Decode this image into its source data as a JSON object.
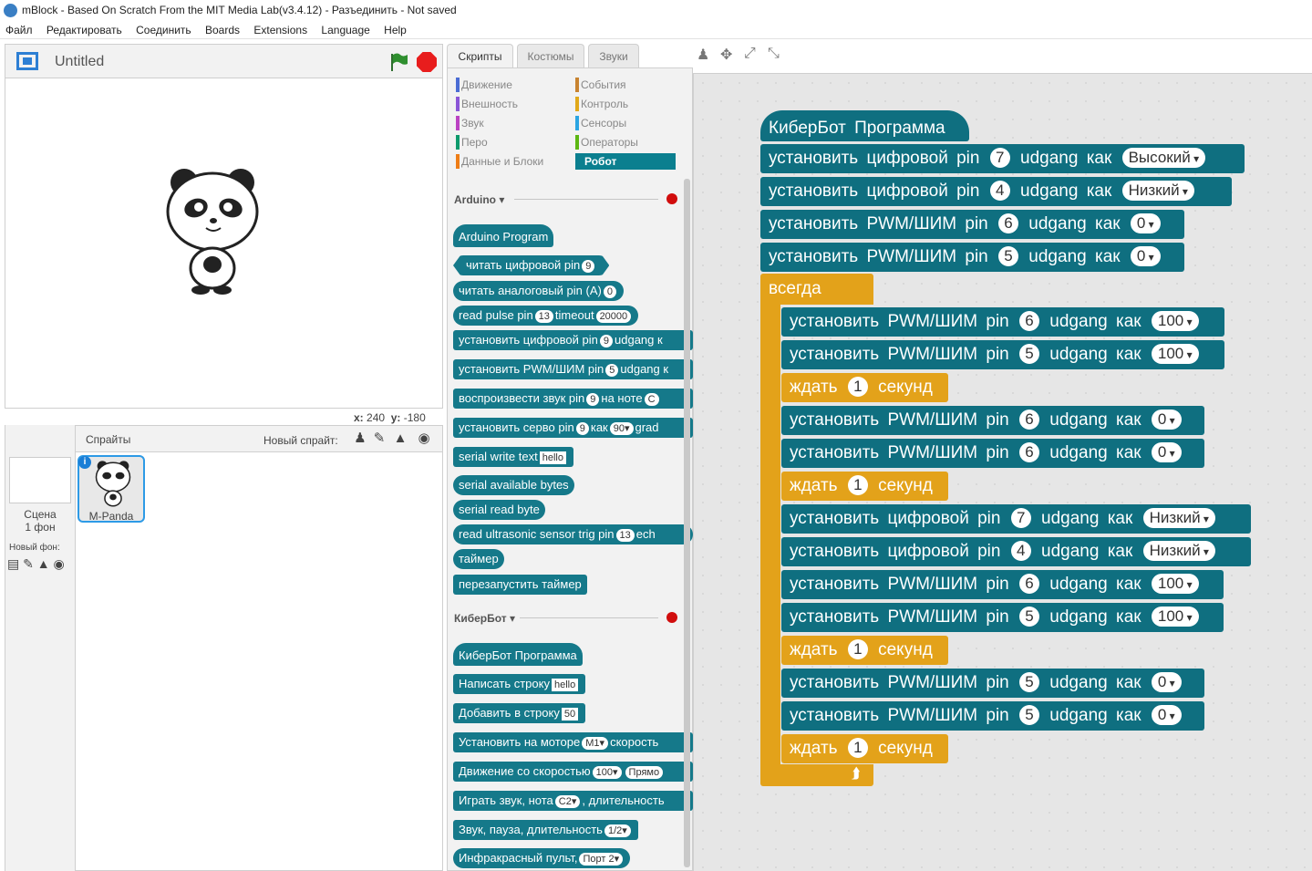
{
  "window": {
    "title": "mBlock - Based On Scratch From the MIT Media Lab(v3.4.12) - Разъединить - Not saved"
  },
  "menu": [
    "Файл",
    "Редактировать",
    "Соединить",
    "Boards",
    "Extensions",
    "Language",
    "Help"
  ],
  "stage": {
    "title": "Untitled",
    "x_label": "x:",
    "x_value": "240",
    "y_label": "y:",
    "y_value": "-180"
  },
  "sprites": {
    "header": "Спрайты",
    "new_sprite": "Новый спрайт:",
    "scene_label": "Сцена",
    "scene_count": "1 фон",
    "new_backdrop": "Новый фон:",
    "sprite_name": "M-Panda"
  },
  "tabs": [
    "Скрипты",
    "Костюмы",
    "Звуки"
  ],
  "categories": {
    "left": [
      {
        "label": "Движение",
        "color": "#4a6cd4"
      },
      {
        "label": "Внешность",
        "color": "#8a55d7"
      },
      {
        "label": "Звук",
        "color": "#bb42c3"
      },
      {
        "label": "Перо",
        "color": "#0e9a6c"
      },
      {
        "label": "Данные и Блоки",
        "color": "#ee7d16"
      }
    ],
    "right": [
      {
        "label": "События",
        "color": "#c88330"
      },
      {
        "label": "Контроль",
        "color": "#e1a91a"
      },
      {
        "label": "Сенсоры",
        "color": "#2ca5e2"
      },
      {
        "label": "Операторы",
        "color": "#5cb712"
      },
      {
        "label": "Робот",
        "color": "#0b7f8f"
      }
    ]
  },
  "palette": {
    "arduino_section": "Arduino",
    "arduino_blocks": [
      {
        "pre": "Arduino Program"
      },
      {
        "pre": "читать цифровой pin",
        "v1": "9"
      },
      {
        "pre": "читать аналоговый pin (A)",
        "v1": "0"
      },
      {
        "pre": "read pulse pin",
        "v1": "13",
        "mid": "timeout",
        "v2": "20000"
      },
      {
        "pre": "установить цифровой pin",
        "v1": "9",
        "mid": "udgang",
        "v2": "к"
      },
      {
        "pre": "установить PWM/ШИМ pin",
        "v1": "5",
        "mid": "udgang",
        "v2": "к"
      },
      {
        "pre": "воспроизвести звук pin",
        "v1": "9",
        "mid": "на ноте",
        "v2": "C"
      },
      {
        "pre": "установить серво pin",
        "v1": "9",
        "mid": "как",
        "v2": "90▾",
        "post": "grad"
      },
      {
        "pre": "serial write text",
        "v1": "hello"
      },
      {
        "pre": "serial available bytes"
      },
      {
        "pre": "serial read byte"
      },
      {
        "pre": "read ultrasonic sensor trig pin",
        "v1": "13",
        "mid": "ech"
      },
      {
        "pre": "таймер"
      },
      {
        "pre": "перезапустить таймер"
      }
    ],
    "kiberbot_section": "КиберБот",
    "kiberbot_blocks": [
      {
        "pre": "КиберБот Программа"
      },
      {
        "pre": "Написать строку",
        "v1": "hello"
      },
      {
        "pre": "Добавить в строку",
        "v1": "50"
      },
      {
        "pre": "Установить на моторе",
        "v1": "M1▾",
        "mid": "скорость"
      },
      {
        "pre": "Движение со скоростью",
        "v1": "100▾",
        "mid": "",
        "v2": "Прямо"
      },
      {
        "pre": "Играть звук, нота",
        "v1": "C2▾",
        "mid": ", длительность"
      },
      {
        "pre": "Звук, пауза, длительность",
        "v1": "1/2▾"
      },
      {
        "pre": "Инфракрасный пульт,",
        "v1": "Порт 2▾"
      }
    ]
  },
  "script": {
    "hat": "КиберБот Программа",
    "setup": [
      {
        "kind": "digital",
        "label": "установить цифровой pin",
        "pin": "7",
        "mid": "udgang как",
        "value": "Высокий"
      },
      {
        "kind": "digital",
        "label": "установить цифровой pin",
        "pin": "4",
        "mid": "udgang как",
        "value": "Низкий"
      },
      {
        "kind": "pwm",
        "label": "установить PWM/ШИМ pin",
        "pin": "6",
        "mid": "udgang как",
        "value": "0"
      },
      {
        "kind": "pwm",
        "label": "установить PWM/ШИМ pin",
        "pin": "5",
        "mid": "udgang как",
        "value": "0"
      }
    ],
    "forever": "всегда",
    "loop": [
      {
        "kind": "pwm",
        "label": "установить PWM/ШИМ pin",
        "pin": "6",
        "mid": "udgang как",
        "value": "100"
      },
      {
        "kind": "pwm",
        "label": "установить PWM/ШИМ pin",
        "pin": "5",
        "mid": "udgang как",
        "value": "100"
      },
      {
        "kind": "wait",
        "label": "ждать",
        "pin": "1",
        "mid": "секунд"
      },
      {
        "kind": "pwm",
        "label": "установить PWM/ШИМ pin",
        "pin": "6",
        "mid": "udgang как",
        "value": "0"
      },
      {
        "kind": "pwm",
        "label": "установить PWM/ШИМ pin",
        "pin": "6",
        "mid": "udgang как",
        "value": "0"
      },
      {
        "kind": "wait",
        "label": "ждать",
        "pin": "1",
        "mid": "секунд"
      },
      {
        "kind": "digital",
        "label": "установить цифровой pin",
        "pin": "7",
        "mid": "udgang как",
        "value": "Низкий"
      },
      {
        "kind": "digital",
        "label": "установить цифровой pin",
        "pin": "4",
        "mid": "udgang как",
        "value": "Низкий"
      },
      {
        "kind": "pwm",
        "label": "установить PWM/ШИМ pin",
        "pin": "6",
        "mid": "udgang как",
        "value": "100"
      },
      {
        "kind": "pwm",
        "label": "установить PWM/ШИМ pin",
        "pin": "5",
        "mid": "udgang как",
        "value": "100"
      },
      {
        "kind": "wait",
        "label": "ждать",
        "pin": "1",
        "mid": "секунд"
      },
      {
        "kind": "pwm",
        "label": "установить PWM/ШИМ pin",
        "pin": "5",
        "mid": "udgang как",
        "value": "0"
      },
      {
        "kind": "pwm",
        "label": "установить PWM/ШИМ pin",
        "pin": "5",
        "mid": "udgang как",
        "value": "0"
      },
      {
        "kind": "wait",
        "label": "ждать",
        "pin": "1",
        "mid": "секунд"
      }
    ]
  },
  "colors": {
    "robot_block": "#0f6f80",
    "control_block": "#e3a21a",
    "stop": "#e81d1d",
    "flag": "#2f8f2f"
  }
}
